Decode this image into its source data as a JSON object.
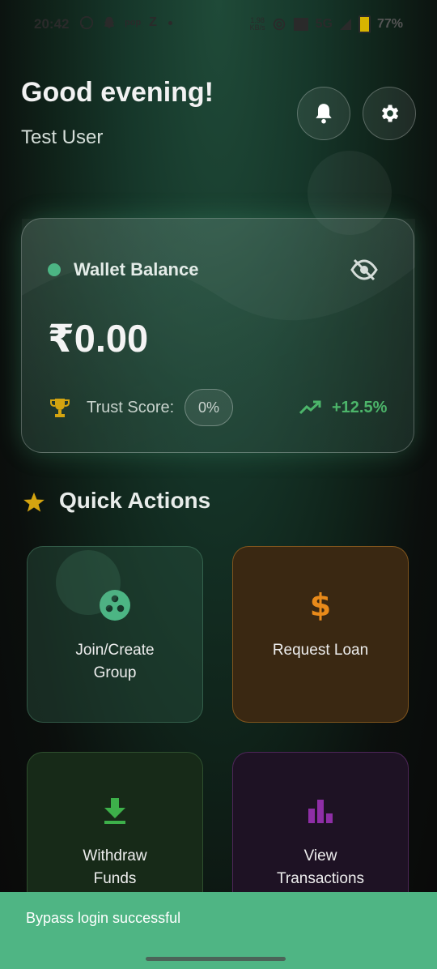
{
  "status_bar": {
    "time": "20:42",
    "icons": [
      "whatsapp-icon",
      "snapchat-icon",
      "pop-icon",
      "z-icon",
      "dot-icon"
    ],
    "pop_text": "pop",
    "z_text": "Z",
    "net_speed_value": "1.98",
    "net_speed_unit": "KB/s",
    "network": "5G",
    "battery": "77%"
  },
  "header": {
    "greeting": "Good evening!",
    "user_name": "Test User"
  },
  "wallet": {
    "title": "Wallet Balance",
    "amount": "₹0.00",
    "trust_label": "Trust Score:",
    "trust_value": "0%",
    "growth": "+12.5%"
  },
  "quick_actions": {
    "title": "Quick Actions",
    "items": [
      {
        "label": "Join/Create Group",
        "icon": "group-icon",
        "color": "#4cb584"
      },
      {
        "label": "Request Loan",
        "icon": "dollar-icon",
        "color": "#e88a1a"
      },
      {
        "label": "Withdraw Funds",
        "icon": "download-icon",
        "color": "#3db04a"
      },
      {
        "label": "View Transactions",
        "icon": "bar-chart-icon",
        "color": "#8e2ea6"
      }
    ]
  },
  "toast": {
    "message": "Bypass login successful"
  },
  "colors": {
    "accent": "#4fb584",
    "growth": "#4cb56a",
    "trophy": "#d4a410"
  }
}
